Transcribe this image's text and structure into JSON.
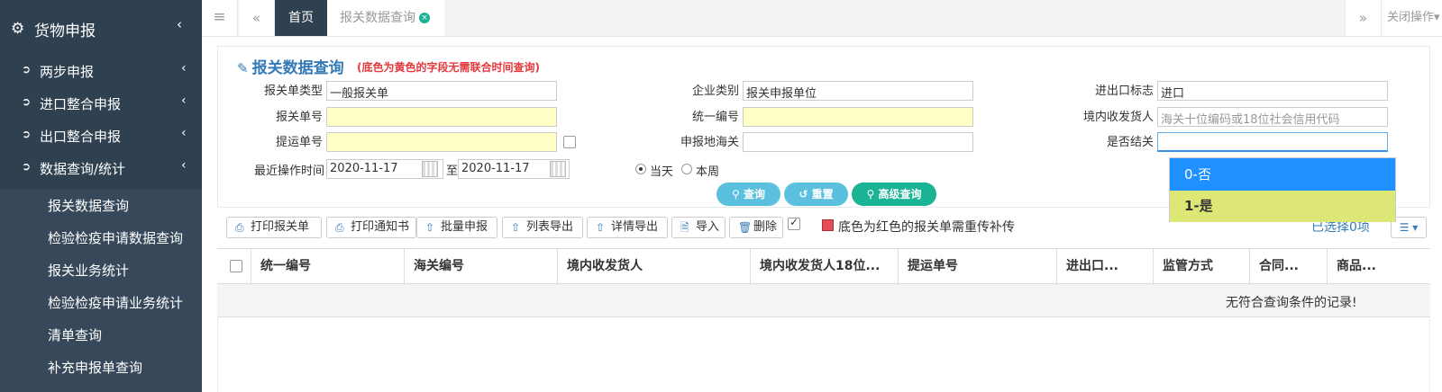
{
  "sidebar": {
    "title": "货物申报",
    "title_icon": "cubes-icon",
    "items": [
      {
        "label": "两步申报",
        "icon": "sign-in-icon"
      },
      {
        "label": "进口整合申报",
        "icon": "sign-in-icon"
      },
      {
        "label": "出口整合申报",
        "icon": "sign-out-icon"
      },
      {
        "label": "数据查询/统计",
        "icon": "sign-out-icon"
      }
    ],
    "subitems": [
      {
        "label": "报关数据查询"
      },
      {
        "label": "检验检疫申请数据查询"
      },
      {
        "label": "报关业务统计"
      },
      {
        "label": "检验检疫申请业务统计"
      },
      {
        "label": "清单查询"
      },
      {
        "label": "补充申报单查询"
      }
    ]
  },
  "topbar": {
    "home_tab": "首页",
    "active_tab": "报关数据查询",
    "close_ops": "关闭操作"
  },
  "panel": {
    "title": "报关数据查询",
    "note": "(底色为黄色的字段无需联合时间查询)",
    "labels": {
      "decl_type": "报关单类型",
      "company_type": "企业类别",
      "ie_flag": "进出口标志",
      "decl_no": "报关单号",
      "unified_no": "统一编号",
      "consignee": "境内收发货人",
      "bl_no": "提运单号",
      "customs": "申报地海关",
      "closed": "是否结关",
      "recent_time": "最近操作时间",
      "to": "至"
    },
    "values": {
      "decl_type": "一般报关单",
      "company_type": "报关申报单位",
      "ie_flag": "进口",
      "consignee_placeholder": "海关十位编码或18位社会信用代码",
      "date_from": "2020-11-17",
      "date_to": "2020-11-17"
    },
    "radios": {
      "today": "当天",
      "week": "本周"
    },
    "buttons": {
      "query": "查询",
      "reset": "重置",
      "advanced": "高级查询"
    },
    "dropdown": [
      "0-否",
      "1-是"
    ]
  },
  "toolbar": {
    "buttons": [
      {
        "label": "打印报关单",
        "icon": "print-icon"
      },
      {
        "label": "打印通知书",
        "icon": "print-icon"
      },
      {
        "label": "批量申报",
        "icon": "upload-icon"
      },
      {
        "label": "列表导出",
        "icon": "upload-icon"
      },
      {
        "label": "详情导出",
        "icon": "upload-icon"
      },
      {
        "label": "导入",
        "icon": "file-icon"
      },
      {
        "label": "删除",
        "icon": "trash-icon"
      }
    ],
    "legend": "底色为红色的报关单需重传补传",
    "selected_count": "已选择0项"
  },
  "table": {
    "headers": [
      "统一编号",
      "海关编号",
      "境内收发货人",
      "境内收发货人18位...",
      "提运单号",
      "进出口...",
      "监管方式",
      "合同...",
      "商品..."
    ],
    "empty_text": "无符合查询条件的记录!"
  },
  "colors": {
    "sidebar_bg": "#2f4050",
    "accent_blue": "#337ab7",
    "pill_blue": "#5bc0de",
    "pill_teal": "#1ab394",
    "yellow_field": "#ffffc6",
    "note_red": "#e4393c"
  }
}
